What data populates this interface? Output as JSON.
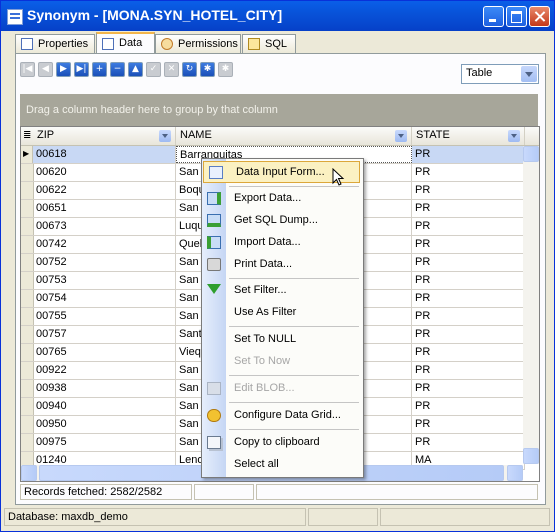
{
  "window": {
    "title": "Synonym - [MONA.SYN_HOTEL_CITY]",
    "icon": "table-window-icon"
  },
  "tabs": [
    {
      "label": "Properties",
      "icon": "properties-icon",
      "active": false
    },
    {
      "label": "Data",
      "icon": "grid-icon",
      "active": true
    },
    {
      "label": "Permissions",
      "icon": "users-icon",
      "active": false
    },
    {
      "label": "SQL",
      "icon": "sql-icon",
      "active": false
    }
  ],
  "navigator": {
    "buttons": [
      "first",
      "prior",
      "next",
      "last",
      "insert",
      "delete",
      "edit",
      "post",
      "cancel",
      "refresh",
      "apply-updates",
      "cancel-updates"
    ],
    "view_select": "Table"
  },
  "group_hint": "Drag a column header here to group by that column",
  "grid": {
    "columns": [
      "ZIP",
      "NAME",
      "STATE"
    ],
    "rows": [
      {
        "zip": "00618",
        "name": "Barranquitas",
        "state": "PR"
      },
      {
        "zip": "00620",
        "name": "San J",
        "state": "PR"
      },
      {
        "zip": "00622",
        "name": "Boqu",
        "state": "PR"
      },
      {
        "zip": "00651",
        "name": "San J",
        "state": "PR"
      },
      {
        "zip": "00673",
        "name": "Luqu",
        "state": "PR"
      },
      {
        "zip": "00742",
        "name": "Queb",
        "state": "PR"
      },
      {
        "zip": "00752",
        "name": "San A",
        "state": "PR"
      },
      {
        "zip": "00753",
        "name": "San J",
        "state": "PR"
      },
      {
        "zip": "00754",
        "name": "San R",
        "state": "PR"
      },
      {
        "zip": "00755",
        "name": "San S",
        "state": "PR"
      },
      {
        "zip": "00757",
        "name": "Santa",
        "state": "PR"
      },
      {
        "zip": "00765",
        "name": "Vieq",
        "state": "PR"
      },
      {
        "zip": "00922",
        "name": "San J",
        "state": "PR"
      },
      {
        "zip": "00938",
        "name": "San J",
        "state": "PR"
      },
      {
        "zip": "00940",
        "name": "San J",
        "state": "PR"
      },
      {
        "zip": "00950",
        "name": "San J",
        "state": "PR"
      },
      {
        "zip": "00975",
        "name": "San J",
        "state": "PR"
      },
      {
        "zip": "01240",
        "name": "Leno",
        "state": "MA"
      }
    ]
  },
  "records_status": "Records fetched: 2582/2582",
  "context_menu": [
    {
      "label": "Data Input Form...",
      "icon": "form-icon",
      "highlighted": true,
      "disabled": false
    },
    {
      "label": "Export Data...",
      "icon": "export-icon",
      "disabled": false
    },
    {
      "label": "Get SQL Dump...",
      "icon": "sql-dump-icon",
      "disabled": false
    },
    {
      "label": "Import Data...",
      "icon": "import-icon",
      "disabled": false
    },
    {
      "label": "Print Data...",
      "icon": "printer-icon",
      "disabled": false
    },
    {
      "label": "Set Filter...",
      "icon": "filter-icon",
      "disabled": false
    },
    {
      "label": "Use As Filter",
      "icon": "",
      "disabled": false
    },
    {
      "label": "Set To NULL",
      "icon": "",
      "disabled": false
    },
    {
      "label": "Set To Now",
      "icon": "",
      "disabled": true
    },
    {
      "label": "Edit BLOB...",
      "icon": "blob-icon",
      "disabled": true
    },
    {
      "label": "Configure Data Grid...",
      "icon": "configure-icon",
      "disabled": false
    },
    {
      "label": "Copy to clipboard",
      "icon": "copy-icon",
      "disabled": false
    },
    {
      "label": "Select all",
      "icon": "",
      "disabled": false
    }
  ],
  "status_bar": {
    "database": "Database: maxdb_demo"
  }
}
